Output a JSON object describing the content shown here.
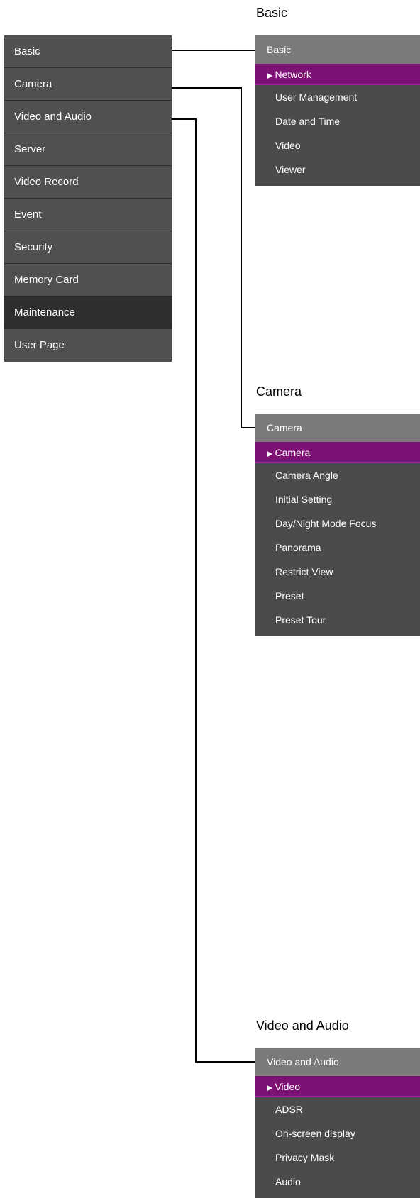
{
  "main_menu": {
    "items": [
      {
        "label": "Basic"
      },
      {
        "label": "Camera"
      },
      {
        "label": "Video and Audio"
      },
      {
        "label": "Server"
      },
      {
        "label": "Video Record"
      },
      {
        "label": "Event"
      },
      {
        "label": "Security"
      },
      {
        "label": "Memory Card"
      },
      {
        "label": "Maintenance"
      },
      {
        "label": "User Page"
      }
    ]
  },
  "sections": {
    "basic": {
      "caption": "Basic",
      "header": "Basic",
      "active": "Network",
      "items": [
        "User Management",
        "Date and Time",
        "Video",
        "Viewer"
      ]
    },
    "camera": {
      "caption": "Camera",
      "header": "Camera",
      "active": "Camera",
      "items": [
        "Camera Angle",
        "Initial Setting",
        "Day/Night Mode Focus",
        "Panorama",
        "Restrict View",
        "Preset",
        "Preset Tour"
      ]
    },
    "video_audio": {
      "caption": "Video and Audio",
      "header": "Video and Audio",
      "active": "Video",
      "items": [
        "ADSR",
        "On-screen display",
        "Privacy Mask",
        "Audio"
      ]
    }
  },
  "colors": {
    "menu_bg": "#505050",
    "highlight": "#7d1275",
    "header_bg": "#7a7a7a"
  },
  "icons": {
    "active_marker": "triangle-right-icon"
  }
}
